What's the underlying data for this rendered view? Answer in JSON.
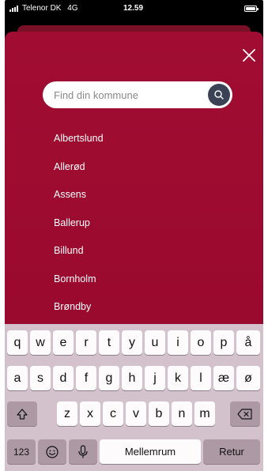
{
  "status_bar": {
    "carrier": "Telenor DK",
    "network": "4G",
    "time": "12.59"
  },
  "search": {
    "placeholder": "Find din kommune",
    "icon": "search-icon"
  },
  "close_icon": "close-icon",
  "municipalities": [
    "Albertslund",
    "Allerød",
    "Assens",
    "Ballerup",
    "Billund",
    "Bornholm",
    "Brøndby"
  ],
  "keyboard": {
    "row1": [
      "q",
      "w",
      "e",
      "r",
      "t",
      "y",
      "u",
      "i",
      "o",
      "p",
      "å"
    ],
    "row2": [
      "a",
      "s",
      "d",
      "f",
      "g",
      "h",
      "j",
      "k",
      "l",
      "æ",
      "ø"
    ],
    "row3": [
      "z",
      "x",
      "c",
      "v",
      "b",
      "n",
      "m"
    ],
    "numbers_label": "123",
    "space_label": "Mellemrum",
    "return_label": "Retur",
    "shift_icon": "shift-icon",
    "backspace_icon": "backspace-icon",
    "emoji_icon": "emoji-icon",
    "mic_icon": "microphone-icon"
  },
  "colors": {
    "sheet": "#a10d32",
    "keyboard": "#d3c2cb",
    "search_button": "#3b4255"
  }
}
